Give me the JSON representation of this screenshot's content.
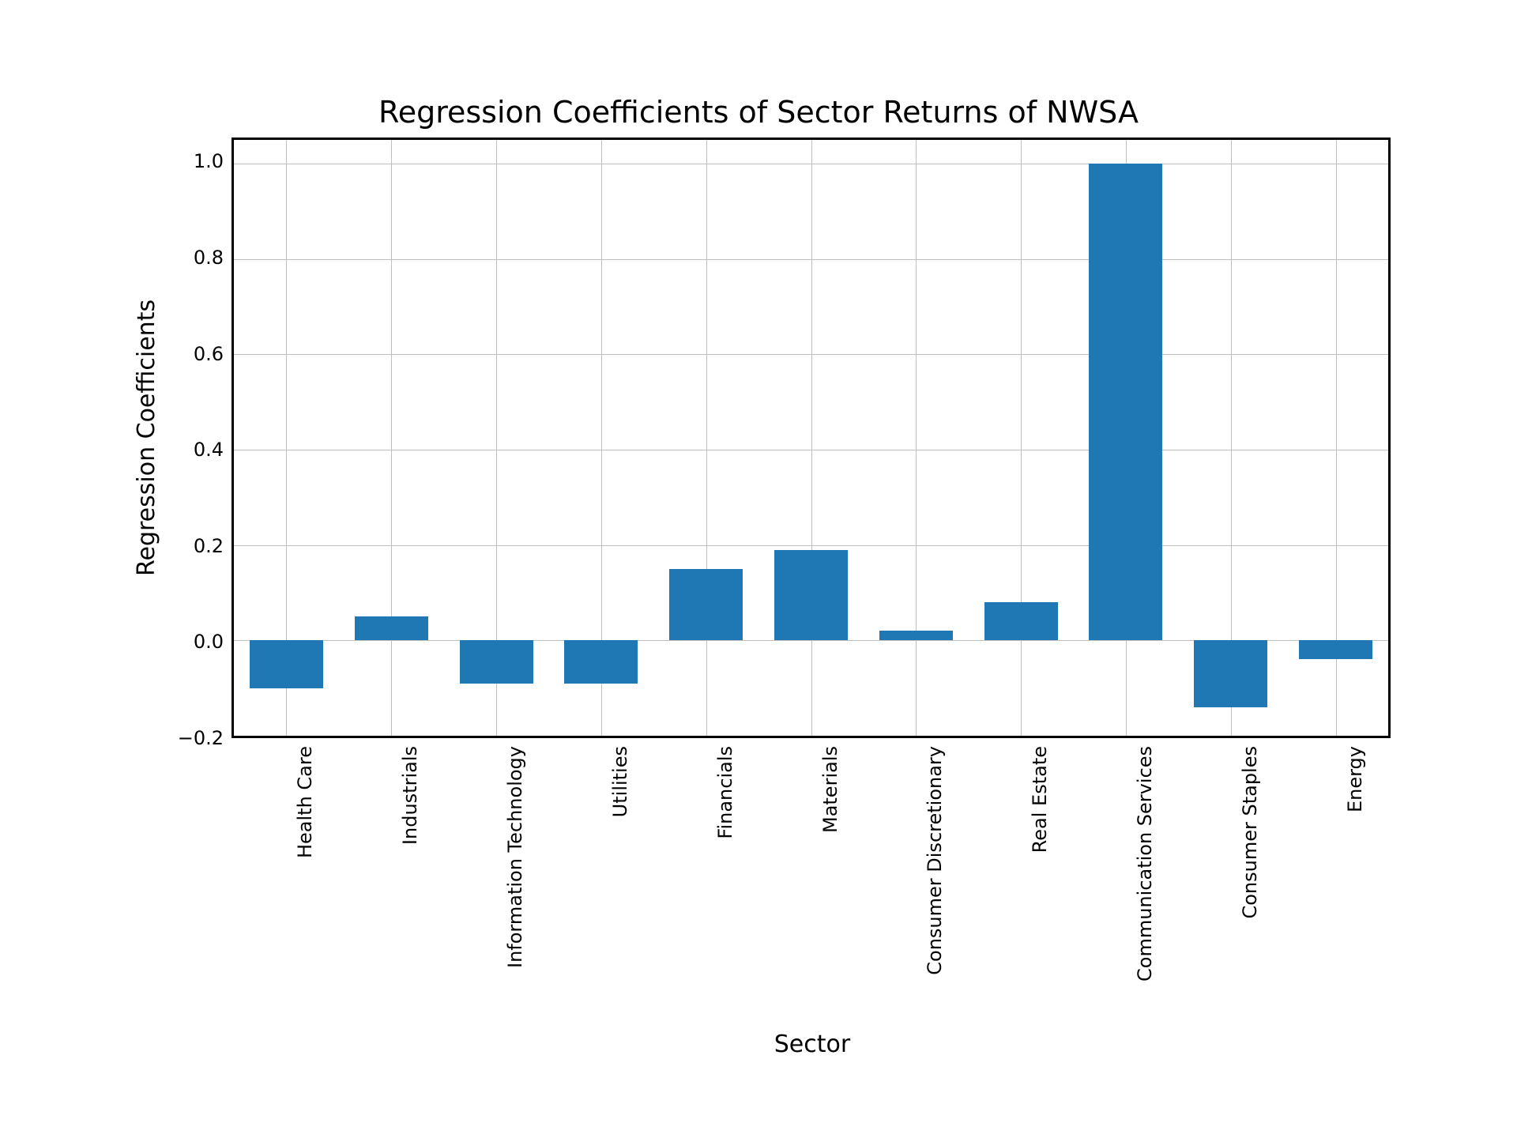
{
  "chart_data": {
    "type": "bar",
    "title": "Regression Coefficients of Sector Returns of NWSA",
    "xlabel": "Sector",
    "ylabel": "Regression Coefficients",
    "categories": [
      "Health Care",
      "Industrials",
      "Information Technology",
      "Utilities",
      "Financials",
      "Materials",
      "Consumer Discretionary",
      "Real Estate",
      "Communication Services",
      "Consumer Staples",
      "Energy"
    ],
    "values": [
      -0.1,
      0.05,
      -0.09,
      -0.09,
      0.15,
      0.19,
      0.02,
      0.08,
      1.0,
      -0.14,
      -0.04
    ],
    "ylim": [
      -0.2,
      1.05
    ],
    "yticks": [
      -0.2,
      0.0,
      0.2,
      0.4,
      0.6,
      0.8,
      1.0
    ],
    "ytick_labels": [
      "−0.2",
      "0.0",
      "0.2",
      "0.4",
      "0.6",
      "0.8",
      "1.0"
    ],
    "bar_color": "#1f77b4",
    "grid": true
  }
}
